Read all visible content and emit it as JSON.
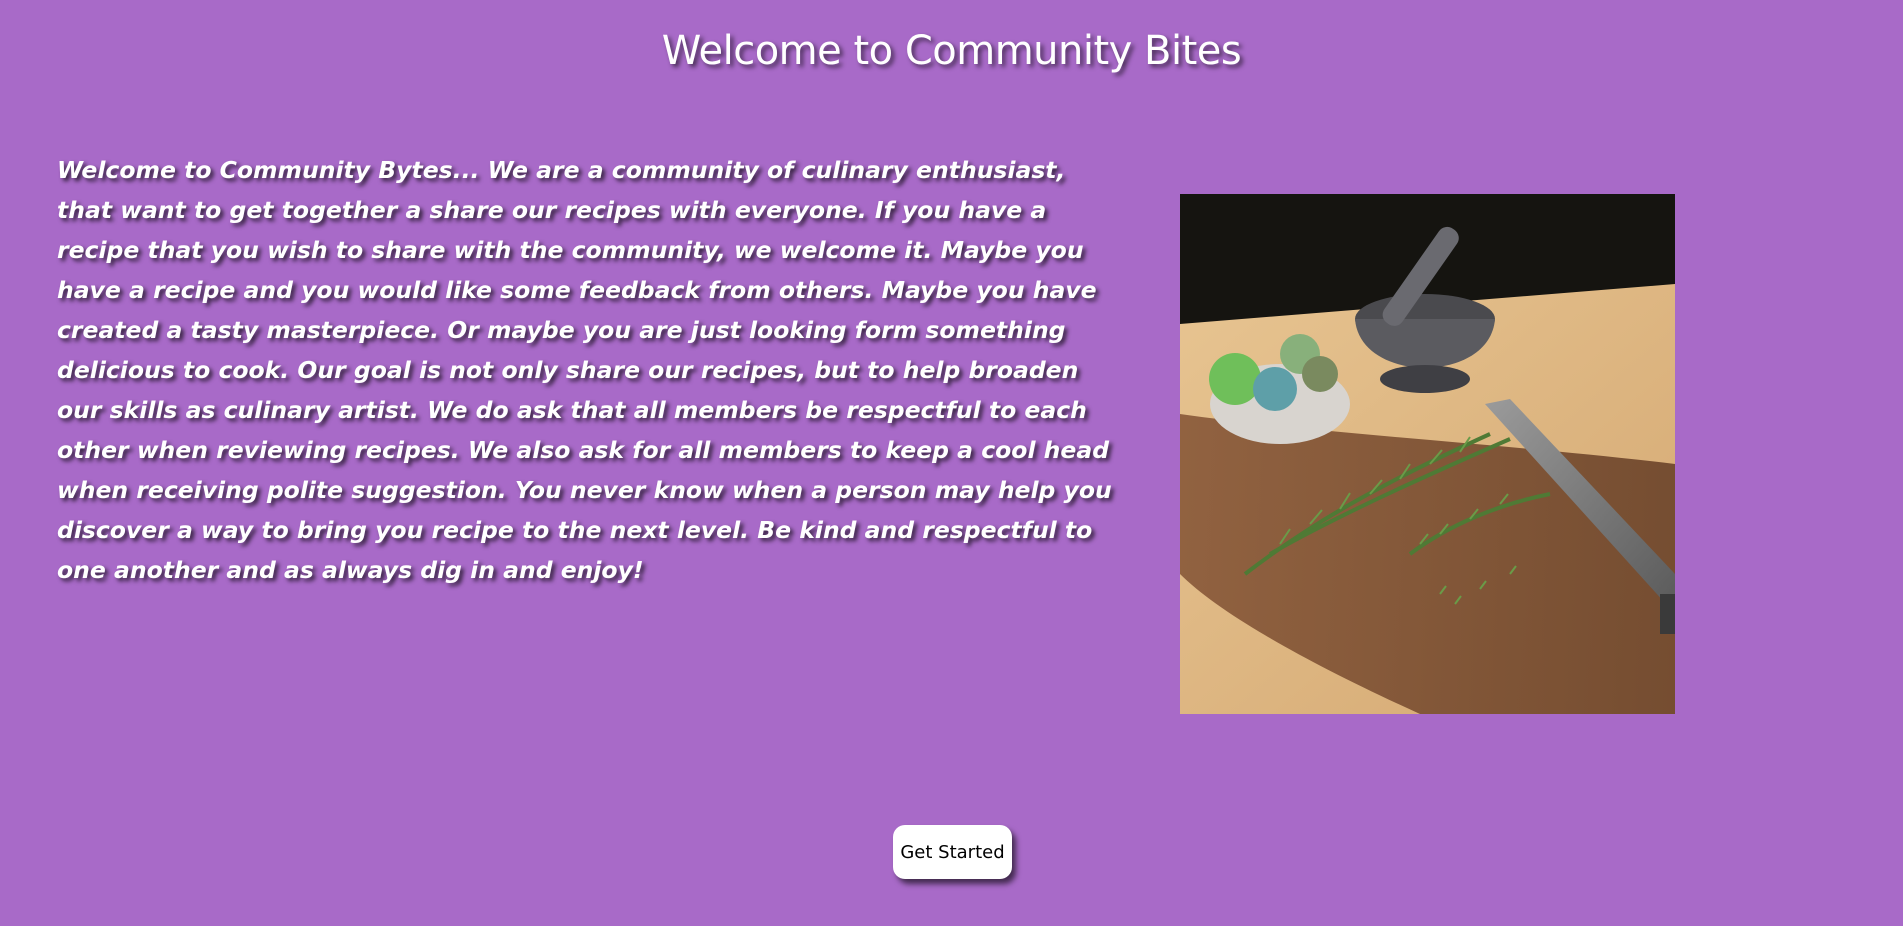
{
  "page": {
    "title": "Welcome to Community Bites",
    "intro": "Welcome to Community Bytes... We are a community of culinary enthusiast, that want to get together a share our recipes with everyone. If you have a recipe that you wish to share with the community, we welcome it. Maybe you have a recipe and you would like some feedback from others. Maybe you have created a tasty masterpiece. Or maybe you are just looking form something delicious to cook. Our goal is not only share our recipes, but to help broaden our skills as culinary artist. We do ask that all members be respectful to each other when reviewing recipes. We also ask for all members to keep a cool head when receiving polite suggestion. You never know when a person may help you discover a way to bring you recipe to the next level. Be kind and respectful to one another and as always dig in and enjoy!"
  },
  "hero_image": {
    "subject": "mortar-and-pestle-rosemary-knife-cutting-board"
  },
  "cta": {
    "label": "Get Started"
  },
  "colors": {
    "background": "#a86ac8",
    "text": "#ffffff",
    "button_bg": "#ffffff",
    "button_text": "#000000"
  }
}
